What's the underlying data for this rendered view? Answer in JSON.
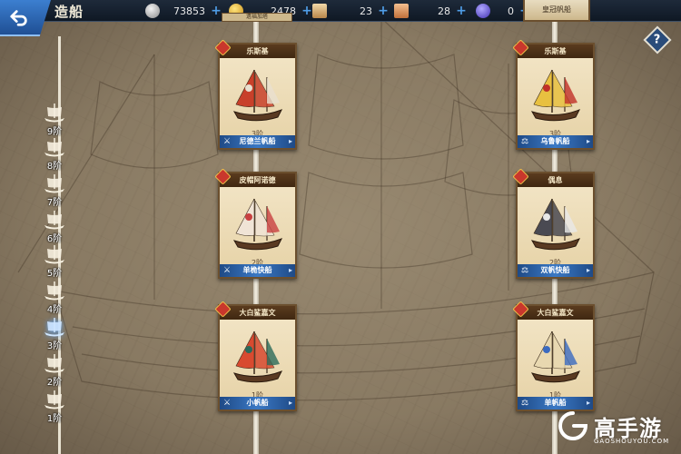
{
  "header": {
    "title": "造船",
    "resources": [
      {
        "icon": "silver-coin-icon",
        "value": "73853",
        "color": "#b9b9b9"
      },
      {
        "icon": "gold-coin-icon",
        "value": "2478",
        "color": "#e8b93a"
      },
      {
        "icon": "scroll-icon",
        "value": "23",
        "color": "#d8b070"
      },
      {
        "icon": "map-icon",
        "value": "28",
        "color": "#e0a070"
      },
      {
        "icon": "gem-icon",
        "value": "0",
        "color": "#6a5ae0"
      }
    ],
    "help_label": "?"
  },
  "tiers": [
    {
      "label": "9阶",
      "active": false
    },
    {
      "label": "8阶",
      "active": false
    },
    {
      "label": "7阶",
      "active": false
    },
    {
      "label": "6阶",
      "active": false
    },
    {
      "label": "5阶",
      "active": false
    },
    {
      "label": "4阶",
      "active": false
    },
    {
      "label": "3阶",
      "active": true
    },
    {
      "label": "2阶",
      "active": false
    },
    {
      "label": "1阶",
      "active": false
    }
  ],
  "partial_cards": {
    "top_left": "遗福加塔",
    "top_right": "皇冠帆船"
  },
  "cards": [
    {
      "header": "乐斯基",
      "level": "3阶",
      "name": "尼德兰帆船",
      "role_icon": "swords-icon",
      "sail_color": "#c8402a",
      "sail_accent": "#e8e0d0"
    },
    {
      "header": "乐斯基",
      "level": "3阶",
      "name": "乌鲁帆船",
      "role_icon": "scales-icon",
      "sail_color": "#e8c040",
      "sail_accent": "#c03028"
    },
    {
      "header": "皮帽阿诺德",
      "level": "2阶",
      "name": "单桅快船",
      "role_icon": "swords-icon",
      "sail_color": "#f0e4d6",
      "sail_accent": "#c84040"
    },
    {
      "header": "偶息",
      "level": "2阶",
      "name": "双帆快船",
      "role_icon": "scales-icon",
      "sail_color": "#4a4a52",
      "sail_accent": "#e8e8e8"
    },
    {
      "header": "大白鲨嘉文",
      "level": "1阶",
      "name": "小帆船",
      "role_icon": "swords-icon",
      "sail_color": "#d84a30",
      "sail_accent": "#2a6a5a"
    },
    {
      "header": "大白鲨嘉文",
      "level": "1阶",
      "name": "单帆船",
      "role_icon": "scales-icon",
      "sail_color": "#e8d8b0",
      "sail_accent": "#3a6ac0"
    }
  ],
  "watermark": {
    "text": "高手游",
    "sub": "GAOSHOUYOU.COM"
  }
}
